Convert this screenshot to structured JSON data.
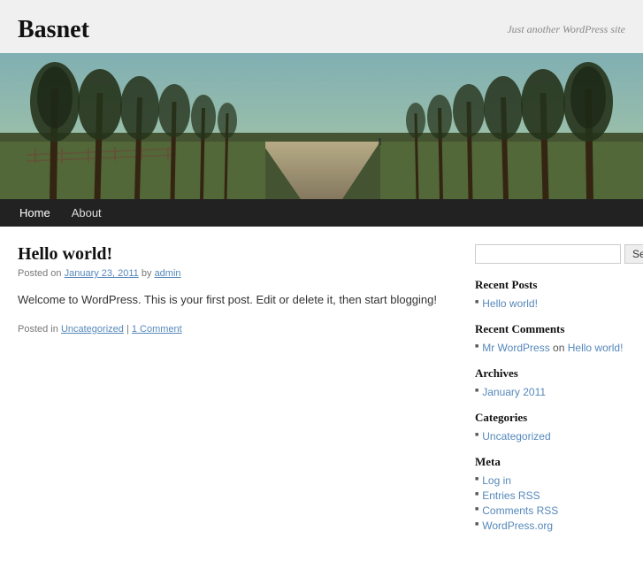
{
  "site": {
    "title": "Basnet",
    "description": "Just another WordPress site"
  },
  "nav": {
    "items": [
      {
        "label": "Home",
        "active": true
      },
      {
        "label": "About",
        "active": false
      }
    ]
  },
  "post": {
    "title": "Hello world!",
    "meta_prefix": "Posted on",
    "date": "January 23, 2011",
    "author_prefix": "by",
    "author": "admin",
    "content": "Welcome to WordPress. This is your first post. Edit or delete it, then start blogging!",
    "footer_prefix": "Posted in",
    "category": "Uncategorized",
    "separator": "|",
    "comment_link": "1 Comment"
  },
  "sidebar": {
    "search_placeholder": "",
    "search_button": "Search",
    "sections": {
      "recent_posts": {
        "title": "Recent Posts",
        "items": [
          "Hello world!"
        ]
      },
      "recent_comments": {
        "title": "Recent Comments",
        "items": [
          {
            "author": "Mr WordPress",
            "on": "on",
            "post": "Hello world!"
          }
        ]
      },
      "archives": {
        "title": "Archives",
        "items": [
          "January 2011"
        ]
      },
      "categories": {
        "title": "Categories",
        "items": [
          "Uncategorized"
        ]
      },
      "meta": {
        "title": "Meta",
        "items": [
          "Log in",
          "Entries RSS",
          "Comments RSS",
          "WordPress.org"
        ]
      }
    }
  }
}
